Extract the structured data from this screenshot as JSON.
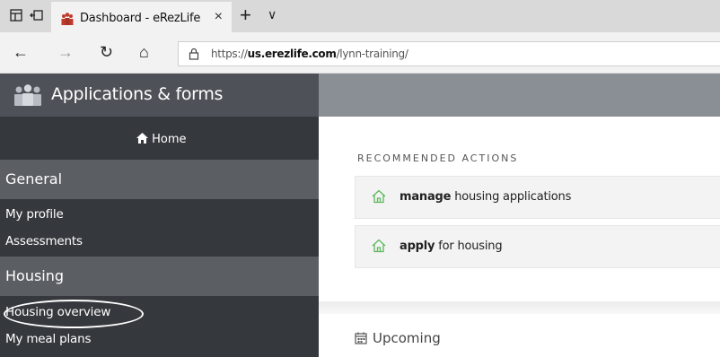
{
  "browser": {
    "tab": {
      "title": "Dashboard - eRezLife",
      "close": "×"
    },
    "new_tab": "+",
    "tab_menu": "∨",
    "back": "←",
    "forward": "→",
    "refresh": "↻",
    "home": "⌂",
    "url_prefix": "https://",
    "url_host": "us.erezlife.com",
    "url_path": "/lynn-training/"
  },
  "app": {
    "title": "Applications & forms"
  },
  "sidebar": {
    "home": "Home",
    "sections": [
      {
        "label": "General",
        "items": [
          "My profile",
          "Assessments"
        ]
      },
      {
        "label": "Housing",
        "items": [
          "Housing overview",
          "My meal plans"
        ]
      }
    ]
  },
  "main": {
    "recommended_heading": "RECOMMENDED ACTIONS",
    "actions": [
      {
        "verb": "manage",
        "rest": " housing applications"
      },
      {
        "verb": "apply",
        "rest": " for housing"
      }
    ],
    "upcoming_heading": "Upcoming"
  },
  "colors": {
    "brand_bg": "#4e5157",
    "header_bg": "#8a8f96",
    "sidebar_bg": "#35383d",
    "section_bg": "#5b5e63",
    "accent_green": "#5cb85c"
  }
}
